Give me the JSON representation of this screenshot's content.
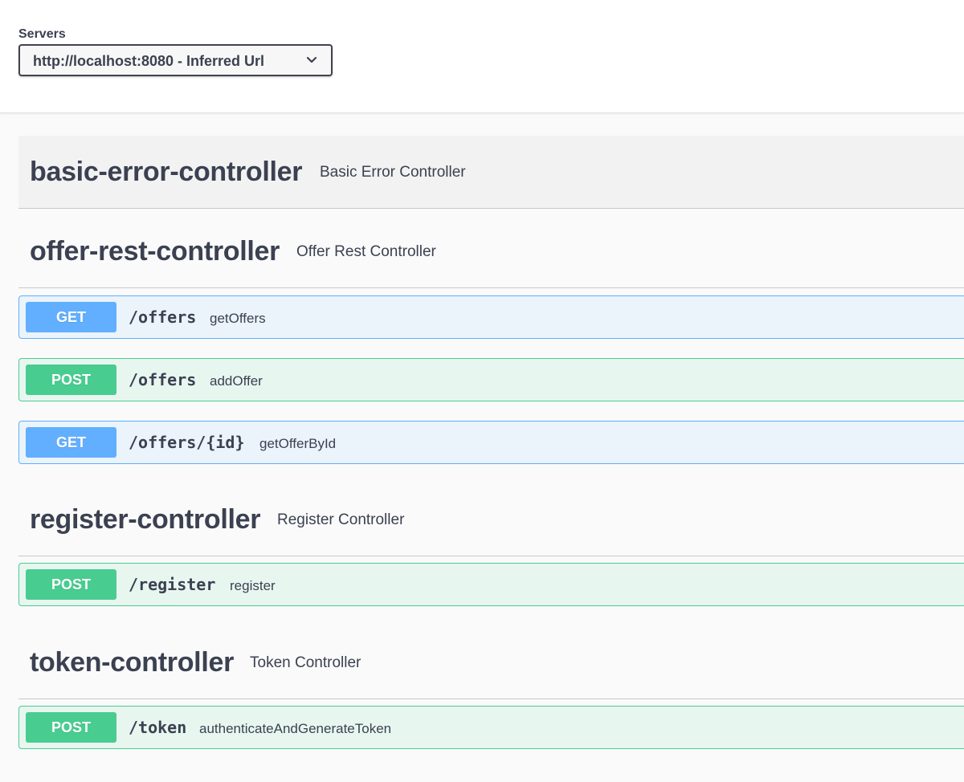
{
  "servers": {
    "label": "Servers",
    "selected": "http://localhost:8080 - Inferred Url",
    "chevron_icon": "chevron-down-icon"
  },
  "tags": [
    {
      "name": "basic-error-controller",
      "description": "Basic Error Controller",
      "operations": []
    },
    {
      "name": "offer-rest-controller",
      "description": "Offer Rest Controller",
      "operations": [
        {
          "method": "GET",
          "path": "/offers",
          "summary": "getOffers"
        },
        {
          "method": "POST",
          "path": "/offers",
          "summary": "addOffer"
        },
        {
          "method": "GET",
          "path": "/offers/{id}",
          "summary": "getOfferById"
        }
      ]
    },
    {
      "name": "register-controller",
      "description": "Register Controller",
      "operations": [
        {
          "method": "POST",
          "path": "/register",
          "summary": "register"
        }
      ]
    },
    {
      "name": "token-controller",
      "description": "Token Controller",
      "operations": [
        {
          "method": "POST",
          "path": "/token",
          "summary": "authenticateAndGenerateToken"
        }
      ]
    }
  ],
  "colors": {
    "get": "#61affe",
    "post": "#49cc90",
    "text": "#3b4151"
  }
}
